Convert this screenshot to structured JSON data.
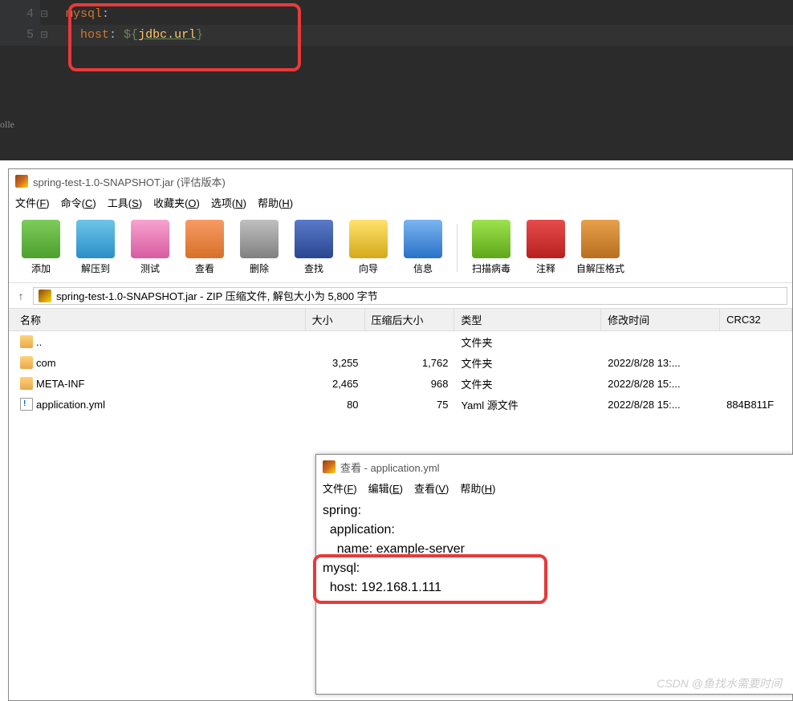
{
  "editor": {
    "line_numbers": [
      "4",
      "5"
    ],
    "sidebar_fragment": "olle",
    "line1": {
      "key": "mysql",
      "colon": ":"
    },
    "line2": {
      "key": "host",
      "colon": ": ",
      "dollar": "${",
      "var": "jdbc.url",
      "close": "}"
    }
  },
  "winrar": {
    "title": "spring-test-1.0-SNAPSHOT.jar (评估版本)",
    "menu": [
      {
        "label": "文件",
        "accel": "F"
      },
      {
        "label": "命令",
        "accel": "C"
      },
      {
        "label": "工具",
        "accel": "S"
      },
      {
        "label": "收藏夹",
        "accel": "O"
      },
      {
        "label": "选项",
        "accel": "N"
      },
      {
        "label": "帮助",
        "accel": "H"
      }
    ],
    "tools": [
      {
        "label": "添加",
        "icon": "ic-add"
      },
      {
        "label": "解压到",
        "icon": "ic-extract"
      },
      {
        "label": "测试",
        "icon": "ic-test"
      },
      {
        "label": "查看",
        "icon": "ic-view"
      },
      {
        "label": "删除",
        "icon": "ic-delete"
      },
      {
        "label": "查找",
        "icon": "ic-find"
      },
      {
        "label": "向导",
        "icon": "ic-wizard"
      },
      {
        "label": "信息",
        "icon": "ic-info"
      },
      {
        "label": "扫描病毒",
        "icon": "ic-virus"
      },
      {
        "label": "注释",
        "icon": "ic-comment"
      },
      {
        "label": "自解压格式",
        "icon": "ic-sfx"
      }
    ],
    "path": "spring-test-1.0-SNAPSHOT.jar - ZIP 压缩文件, 解包大小为 5,800 字节",
    "columns": [
      "名称",
      "大小",
      "压缩后大小",
      "类型",
      "修改时间",
      "CRC32"
    ],
    "rows": [
      {
        "name": "..",
        "size": "",
        "packed": "",
        "type": "文件夹",
        "modified": "",
        "crc": "",
        "icon": "folder"
      },
      {
        "name": "com",
        "size": "3,255",
        "packed": "1,762",
        "type": "文件夹",
        "modified": "2022/8/28 13:...",
        "crc": "",
        "icon": "folder"
      },
      {
        "name": "META-INF",
        "size": "2,465",
        "packed": "968",
        "type": "文件夹",
        "modified": "2022/8/28 15:...",
        "crc": "",
        "icon": "folder"
      },
      {
        "name": "application.yml",
        "size": "80",
        "packed": "75",
        "type": "Yaml 源文件",
        "modified": "2022/8/28 15:...",
        "crc": "884B811F",
        "icon": "file"
      }
    ]
  },
  "viewer": {
    "title": "查看 - application.yml",
    "menu": [
      {
        "label": "文件",
        "accel": "F"
      },
      {
        "label": "编辑",
        "accel": "E"
      },
      {
        "label": "查看",
        "accel": "V"
      },
      {
        "label": "帮助",
        "accel": "H"
      }
    ],
    "content": [
      "spring:",
      "  application:",
      "    name: example-server",
      "mysql:",
      "  host: 192.168.1.111"
    ]
  },
  "watermark": "CSDN @鱼找水需要时间"
}
